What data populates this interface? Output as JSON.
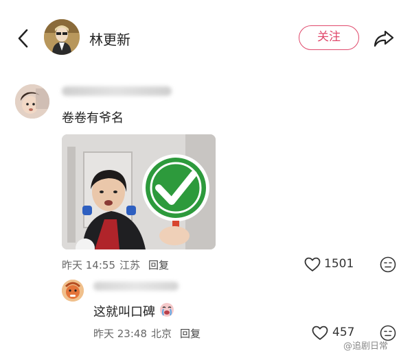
{
  "header": {
    "author_name": "林更新",
    "follow_label": "关注"
  },
  "comments": [
    {
      "text": "卷卷有爷名",
      "time": "昨天 14:55",
      "location": "江苏",
      "reply_label": "回复",
      "likes": "1501",
      "image_badge": "check-mark"
    },
    {
      "text": "这就叫口碑",
      "time": "昨天 23:48",
      "location": "北京",
      "reply_label": "回复",
      "likes": "457"
    }
  ],
  "watermark": "@追剧日常",
  "colors": {
    "accent": "#e0486b",
    "badge_green": "#2d9a3c"
  }
}
